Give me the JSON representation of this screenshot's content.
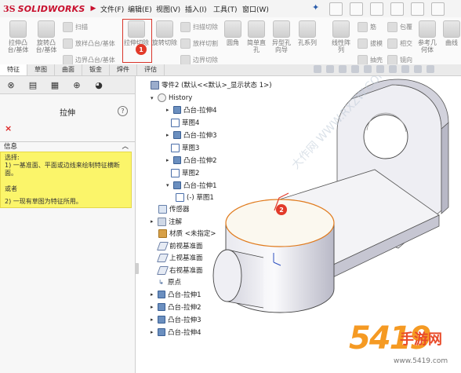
{
  "titlebar": {
    "logo": "SOLIDWORKS",
    "menus": [
      "文件(F)",
      "编辑(E)",
      "视图(V)",
      "插入(I)",
      "工具(T)",
      "窗口(W)"
    ]
  },
  "toolbar": {
    "big1": "拉伸凸台/基体",
    "big2": "旋转凸台/基体",
    "sweep": "扫描",
    "loft": "放样凸台/基体",
    "boundary": "边界凸台/基体",
    "cut_extrude": "拉伸切除",
    "cut_revolve": "旋转切除",
    "cut_sweep": "扫描切除",
    "cut_loft": "放样切割",
    "cut_boundary": "边界切除",
    "fillet": "圆角",
    "hole_wizard": "异型孔向导",
    "hole_series": "孔系列",
    "linear_pattern": "线性阵列",
    "rib": "筋",
    "draft": "拔模",
    "shell": "抽壳",
    "wrap": "包覆",
    "intersect": "相交",
    "mirror": "镜向",
    "ref_geom": "参考几何体",
    "simple_hole": "简单直孔",
    "curves": "曲线",
    "badge1": "1"
  },
  "tabs": [
    "特征",
    "草图",
    "曲面",
    "钣金",
    "焊件",
    "评估"
  ],
  "property_manager": {
    "title": "拉伸",
    "help": "?",
    "close": "×",
    "info_header": "信息",
    "info_lines": [
      "选择:",
      "1) 一基准面、平面或边线来绘制特征横断面。",
      "或者",
      "2) 一现有草图为特征所用。"
    ]
  },
  "tree": {
    "root": "零件2 (默认<<默认>_显示状态 1>)",
    "history": "History",
    "history_items": [
      "凸台-拉伸4",
      "草图4",
      "凸台-拉伸3",
      "草图3",
      "凸台-拉伸2",
      "草图2",
      "凸台-拉伸1",
      "(-) 草图1"
    ],
    "sensors": "传感器",
    "annotations": "注解",
    "material": "材质 <未指定>",
    "front_plane": "前视基准面",
    "top_plane": "上视基准面",
    "right_plane": "右视基准面",
    "origin": "原点",
    "features": [
      "凸台-拉伸1",
      "凸台-拉伸2",
      "凸台-拉伸3",
      "凸台-拉伸4"
    ]
  },
  "canvas": {
    "badge2": "2"
  },
  "watermarks": {
    "diag": "大作网 WWW.RXZW.COM",
    "brand": "5419",
    "site": "手游网",
    "domain": "www.5419.com"
  }
}
